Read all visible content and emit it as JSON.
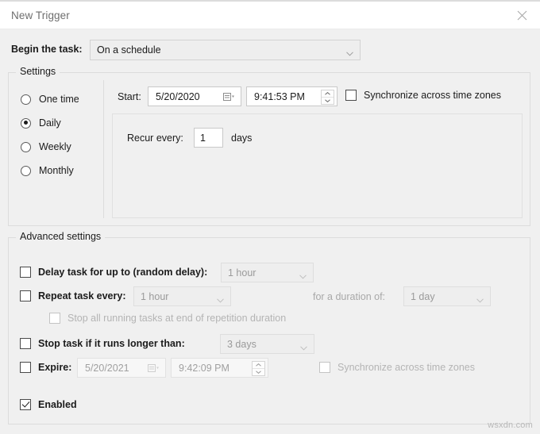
{
  "window": {
    "title": "New Trigger",
    "close_icon": "close-icon"
  },
  "begin_task": {
    "label": "Begin the task:",
    "value": "On a schedule",
    "options": [
      "On a schedule"
    ]
  },
  "settings": {
    "group_label": "Settings",
    "schedule_options": [
      {
        "label": "One time",
        "selected": false
      },
      {
        "label": "Daily",
        "selected": true
      },
      {
        "label": "Weekly",
        "selected": false
      },
      {
        "label": "Monthly",
        "selected": false
      }
    ],
    "start": {
      "label": "Start:",
      "date": "5/20/2020",
      "time": "9:41:53 PM",
      "calendar_icon": "calendar-icon",
      "spinner_icon": "updown-spinner-icon"
    },
    "sync_time_zones": {
      "label": "Synchronize across time zones",
      "checked": false,
      "disabled": false
    },
    "recur": {
      "label": "Recur every:",
      "value": "1",
      "unit": "days"
    }
  },
  "advanced": {
    "group_label": "Advanced settings",
    "delay_task": {
      "label": "Delay task for up to (random delay):",
      "checked": false,
      "value": "1 hour"
    },
    "repeat_task": {
      "label": "Repeat task every:",
      "checked": false,
      "value": "1 hour",
      "duration_label": "for a duration of:",
      "duration_value": "1 day"
    },
    "stop_all_running": {
      "label": "Stop all running tasks at end of repetition duration",
      "checked": false,
      "disabled": true
    },
    "stop_task": {
      "label": "Stop task if it runs longer than:",
      "checked": false,
      "value": "3 days"
    },
    "expire": {
      "label": "Expire:",
      "checked": false,
      "date": "5/20/2021",
      "time": "9:42:09 PM",
      "sync_label": "Synchronize across time zones",
      "sync_checked": false
    },
    "enabled": {
      "label": "Enabled",
      "checked": true
    }
  },
  "watermark": "wsxdn.com"
}
